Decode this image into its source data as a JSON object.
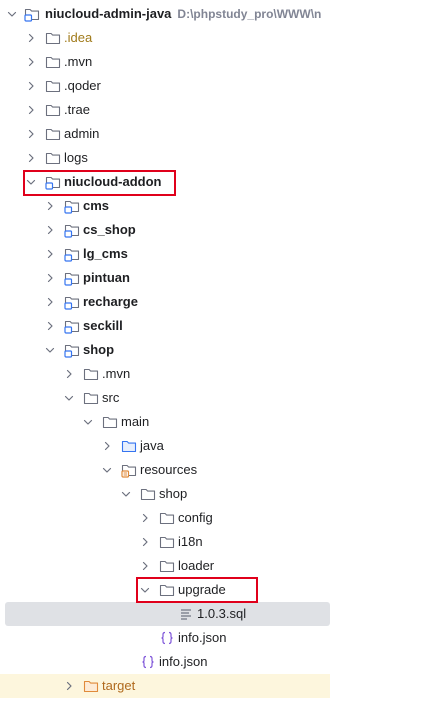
{
  "tree": {
    "root": {
      "name": "niucloud-admin-java",
      "path": "D:\\phpstudy_pro\\WWW\\n"
    },
    "folders": {
      "idea": ".idea",
      "mvn": ".mvn",
      "qoder": ".qoder",
      "trae": ".trae",
      "admin": "admin",
      "logs": "logs",
      "addon": "niucloud-addon",
      "cms": "cms",
      "cs_shop": "cs_shop",
      "lg_cms": "lg_cms",
      "pintuan": "pintuan",
      "recharge": "recharge",
      "seckill": "seckill",
      "shop": "shop",
      "shop_mvn": ".mvn",
      "src": "src",
      "main": "main",
      "java": "java",
      "resources": "resources",
      "res_shop": "shop",
      "config": "config",
      "i18n": "i18n",
      "loader": "loader",
      "upgrade": "upgrade",
      "target": "target"
    },
    "files": {
      "sql": "1.0.3.sql",
      "info_inner": "info.json",
      "info_outer": "info.json"
    }
  },
  "colors": {
    "highlight_box": "#e0001b",
    "selected_row": "#dfe1e5",
    "excluded_row": "#fdf6dd",
    "folder_stroke": "#6c707e",
    "module_accent": "#3574f0",
    "json_icon": "#7f56d9",
    "target_folder": "#e08a3a"
  },
  "icons": {
    "folder": "folder-icon",
    "module": "module-folder-icon",
    "resources": "resources-folder-icon",
    "java_source": "source-folder-icon",
    "sql": "sql-file-icon",
    "json": "json-file-icon",
    "excluded": "excluded-folder-icon",
    "expanded": "chevron-down-icon",
    "collapsed": "chevron-right-icon"
  }
}
